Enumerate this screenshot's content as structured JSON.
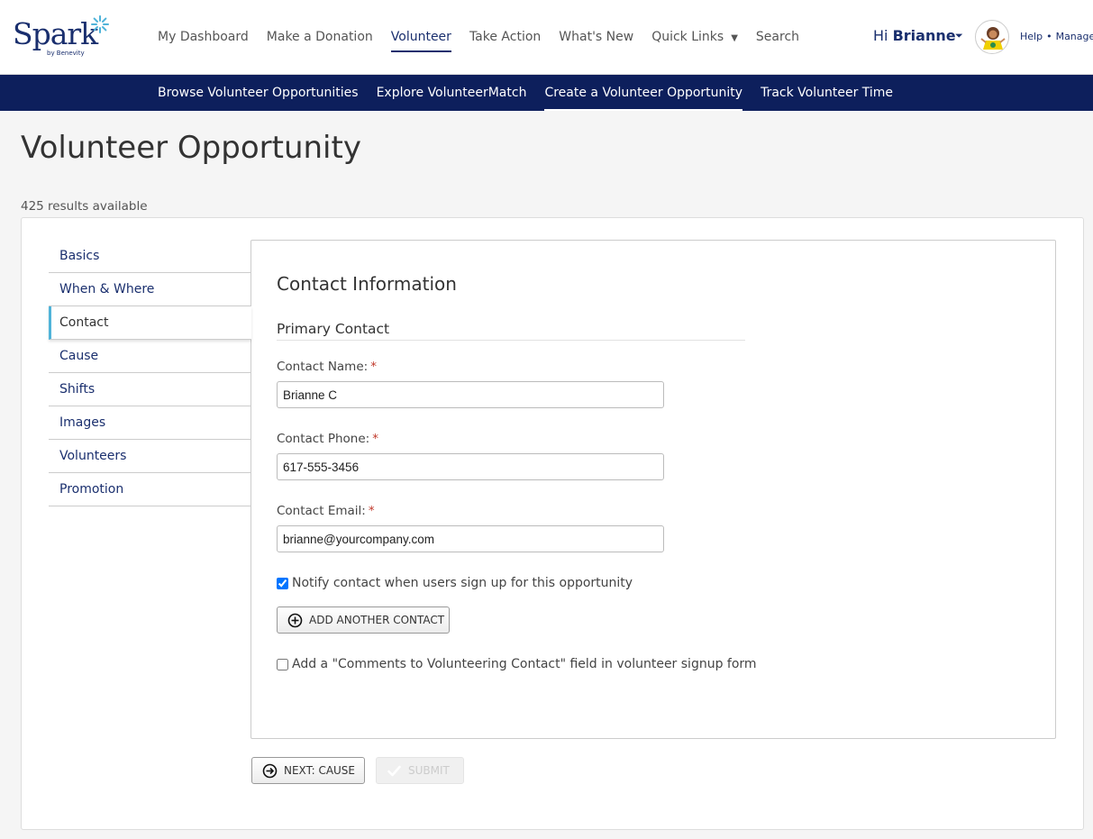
{
  "brand": {
    "name": "Spark",
    "sub": "by Benevity",
    "accent": "#1a2f6e",
    "nav_dark": "#0d1f5c",
    "highlight": "#4fb3d9"
  },
  "nav": {
    "items": [
      {
        "label": "My Dashboard"
      },
      {
        "label": "Make a Donation"
      },
      {
        "label": "Volunteer"
      },
      {
        "label": "Take Action"
      },
      {
        "label": "What's New"
      },
      {
        "label": "Quick Links"
      },
      {
        "label": "Search"
      }
    ],
    "active": "Volunteer",
    "quick_links_caret": "▼"
  },
  "user": {
    "greeting": "Hi",
    "name": "Brianne",
    "help": "Help",
    "manage": "Manage",
    "dot": "•",
    "caret": "⏷"
  },
  "subnav": {
    "items": [
      {
        "label": "Browse Volunteer Opportunities"
      },
      {
        "label": "Explore VolunteerMatch"
      },
      {
        "label": "Create a Volunteer Opportunity"
      },
      {
        "label": "Track Volunteer Time"
      }
    ],
    "active": "Create a Volunteer Opportunity"
  },
  "page": {
    "title": "Volunteer Opportunity",
    "results": "425 results available"
  },
  "sidebar": {
    "items": [
      {
        "label": "Basics"
      },
      {
        "label": "When & Where"
      },
      {
        "label": "Contact"
      },
      {
        "label": "Cause"
      },
      {
        "label": "Shifts"
      },
      {
        "label": "Images"
      },
      {
        "label": "Volunteers"
      },
      {
        "label": "Promotion"
      }
    ],
    "active": "Contact"
  },
  "form": {
    "section_title": "Contact Information",
    "subsection_title": "Primary Contact",
    "required_mark": "*",
    "fields": {
      "name": {
        "label": "Contact Name:",
        "value": "Brianne C"
      },
      "phone": {
        "label": "Contact Phone:",
        "value": "617-555-3456"
      },
      "email": {
        "label": "Contact Email:",
        "value": "brianne@yourcompany.com"
      }
    },
    "notify": {
      "label": "Notify contact when users sign up for this opportunity",
      "checked": true
    },
    "add_contact_label": "ADD ANOTHER CONTACT",
    "comments_field": {
      "label": "Add a \"Comments to Volunteering Contact\" field in volunteer signup form",
      "checked": false
    }
  },
  "actions": {
    "next_label": "NEXT: CAUSE",
    "submit_label": "SUBMIT"
  }
}
